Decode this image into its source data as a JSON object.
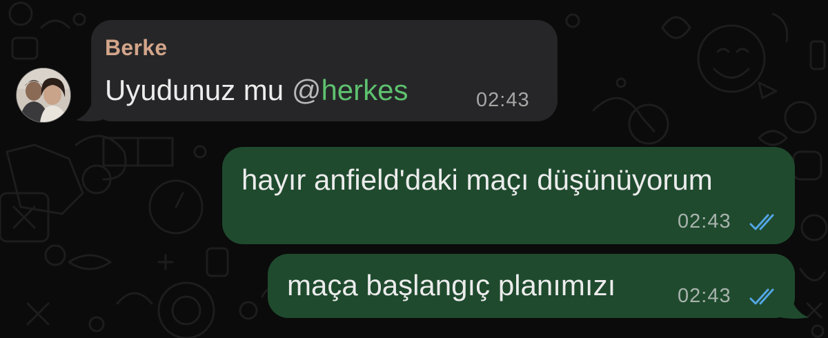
{
  "chat": {
    "messages": [
      {
        "direction": "incoming",
        "sender": "Berke",
        "text_before": "Uyudunuz mu ",
        "mention_at": "@",
        "mention_name": "herkes",
        "time": "02:43"
      },
      {
        "direction": "outgoing",
        "text": "hayır anfield'daki maçı düşünüyorum",
        "time": "02:43",
        "status": "read"
      },
      {
        "direction": "outgoing",
        "text": "maça başlangıç planımızı",
        "time": "02:43",
        "status": "read"
      }
    ]
  },
  "colors": {
    "background": "#0b0b0b",
    "incoming_bubble": "#262628",
    "outgoing_bubble": "#1f4a2e",
    "sender_name": "#d2a58a",
    "mention": "#5ec16f",
    "read_ticks": "#53a6e6"
  },
  "icons": [
    "avatar-photo",
    "read-double-check-icon",
    "wallpaper-doodle-pattern"
  ]
}
